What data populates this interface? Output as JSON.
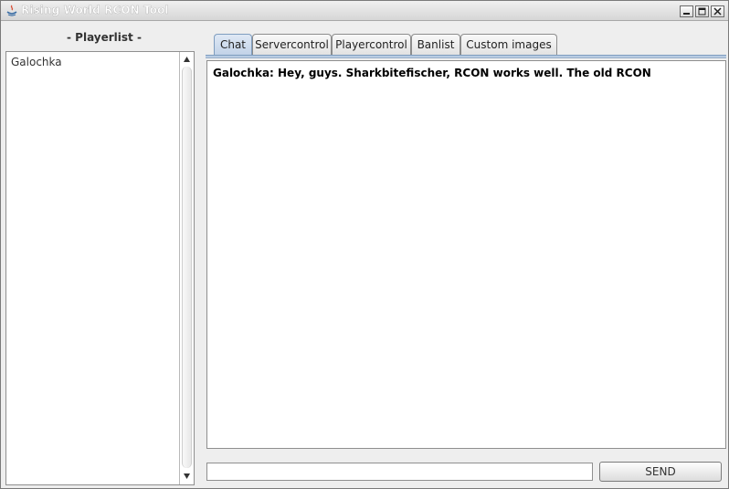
{
  "window": {
    "title": "Rising World RCON Tool"
  },
  "playerlist": {
    "heading": "- Playerlist -",
    "players": [
      "Galochka"
    ]
  },
  "tabs": [
    {
      "label": "Chat",
      "active": true
    },
    {
      "label": "Servercontrol",
      "active": false
    },
    {
      "label": "Playercontrol",
      "active": false
    },
    {
      "label": "Banlist",
      "active": false
    },
    {
      "label": "Custom images",
      "active": false
    }
  ],
  "chat": {
    "messages": [
      "Galochka: Hey, guys. Sharkbitefischer, RCON works well. The old RCON"
    ],
    "input_value": "",
    "send_label": "SEND"
  },
  "colors": {
    "active_tab": "#c2d3e8",
    "tab_strip": "#b8cce3",
    "background": "#eeeeee"
  }
}
